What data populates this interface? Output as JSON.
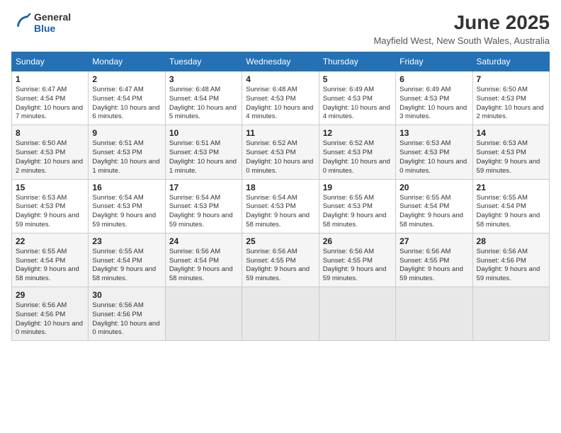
{
  "logo": {
    "general": "General",
    "blue": "Blue"
  },
  "title": "June 2025",
  "location": "Mayfield West, New South Wales, Australia",
  "days_of_week": [
    "Sunday",
    "Monday",
    "Tuesday",
    "Wednesday",
    "Thursday",
    "Friday",
    "Saturday"
  ],
  "weeks": [
    [
      {
        "day": "1",
        "sunrise": "6:47 AM",
        "sunset": "4:54 PM",
        "daylight": "10 hours and 7 minutes."
      },
      {
        "day": "2",
        "sunrise": "6:47 AM",
        "sunset": "4:54 PM",
        "daylight": "10 hours and 6 minutes."
      },
      {
        "day": "3",
        "sunrise": "6:48 AM",
        "sunset": "4:54 PM",
        "daylight": "10 hours and 5 minutes."
      },
      {
        "day": "4",
        "sunrise": "6:48 AM",
        "sunset": "4:53 PM",
        "daylight": "10 hours and 4 minutes."
      },
      {
        "day": "5",
        "sunrise": "6:49 AM",
        "sunset": "4:53 PM",
        "daylight": "10 hours and 4 minutes."
      },
      {
        "day": "6",
        "sunrise": "6:49 AM",
        "sunset": "4:53 PM",
        "daylight": "10 hours and 3 minutes."
      },
      {
        "day": "7",
        "sunrise": "6:50 AM",
        "sunset": "4:53 PM",
        "daylight": "10 hours and 2 minutes."
      }
    ],
    [
      {
        "day": "8",
        "sunrise": "6:50 AM",
        "sunset": "4:53 PM",
        "daylight": "10 hours and 2 minutes."
      },
      {
        "day": "9",
        "sunrise": "6:51 AM",
        "sunset": "4:53 PM",
        "daylight": "10 hours and 1 minute."
      },
      {
        "day": "10",
        "sunrise": "6:51 AM",
        "sunset": "4:53 PM",
        "daylight": "10 hours and 1 minute."
      },
      {
        "day": "11",
        "sunrise": "6:52 AM",
        "sunset": "4:53 PM",
        "daylight": "10 hours and 0 minutes."
      },
      {
        "day": "12",
        "sunrise": "6:52 AM",
        "sunset": "4:53 PM",
        "daylight": "10 hours and 0 minutes."
      },
      {
        "day": "13",
        "sunrise": "6:53 AM",
        "sunset": "4:53 PM",
        "daylight": "10 hours and 0 minutes."
      },
      {
        "day": "14",
        "sunrise": "6:53 AM",
        "sunset": "4:53 PM",
        "daylight": "9 hours and 59 minutes."
      }
    ],
    [
      {
        "day": "15",
        "sunrise": "6:53 AM",
        "sunset": "4:53 PM",
        "daylight": "9 hours and 59 minutes."
      },
      {
        "day": "16",
        "sunrise": "6:54 AM",
        "sunset": "4:53 PM",
        "daylight": "9 hours and 59 minutes."
      },
      {
        "day": "17",
        "sunrise": "6:54 AM",
        "sunset": "4:53 PM",
        "daylight": "9 hours and 59 minutes."
      },
      {
        "day": "18",
        "sunrise": "6:54 AM",
        "sunset": "4:53 PM",
        "daylight": "9 hours and 58 minutes."
      },
      {
        "day": "19",
        "sunrise": "6:55 AM",
        "sunset": "4:53 PM",
        "daylight": "9 hours and 58 minutes."
      },
      {
        "day": "20",
        "sunrise": "6:55 AM",
        "sunset": "4:54 PM",
        "daylight": "9 hours and 58 minutes."
      },
      {
        "day": "21",
        "sunrise": "6:55 AM",
        "sunset": "4:54 PM",
        "daylight": "9 hours and 58 minutes."
      }
    ],
    [
      {
        "day": "22",
        "sunrise": "6:55 AM",
        "sunset": "4:54 PM",
        "daylight": "9 hours and 58 minutes."
      },
      {
        "day": "23",
        "sunrise": "6:55 AM",
        "sunset": "4:54 PM",
        "daylight": "9 hours and 58 minutes."
      },
      {
        "day": "24",
        "sunrise": "6:56 AM",
        "sunset": "4:54 PM",
        "daylight": "9 hours and 58 minutes."
      },
      {
        "day": "25",
        "sunrise": "6:56 AM",
        "sunset": "4:55 PM",
        "daylight": "9 hours and 59 minutes."
      },
      {
        "day": "26",
        "sunrise": "6:56 AM",
        "sunset": "4:55 PM",
        "daylight": "9 hours and 59 minutes."
      },
      {
        "day": "27",
        "sunrise": "6:56 AM",
        "sunset": "4:55 PM",
        "daylight": "9 hours and 59 minutes."
      },
      {
        "day": "28",
        "sunrise": "6:56 AM",
        "sunset": "4:56 PM",
        "daylight": "9 hours and 59 minutes."
      }
    ],
    [
      {
        "day": "29",
        "sunrise": "6:56 AM",
        "sunset": "4:56 PM",
        "daylight": "10 hours and 0 minutes."
      },
      {
        "day": "30",
        "sunrise": "6:56 AM",
        "sunset": "4:56 PM",
        "daylight": "10 hours and 0 minutes."
      },
      null,
      null,
      null,
      null,
      null
    ]
  ],
  "labels": {
    "sunrise": "Sunrise:",
    "sunset": "Sunset:",
    "daylight": "Daylight:"
  }
}
